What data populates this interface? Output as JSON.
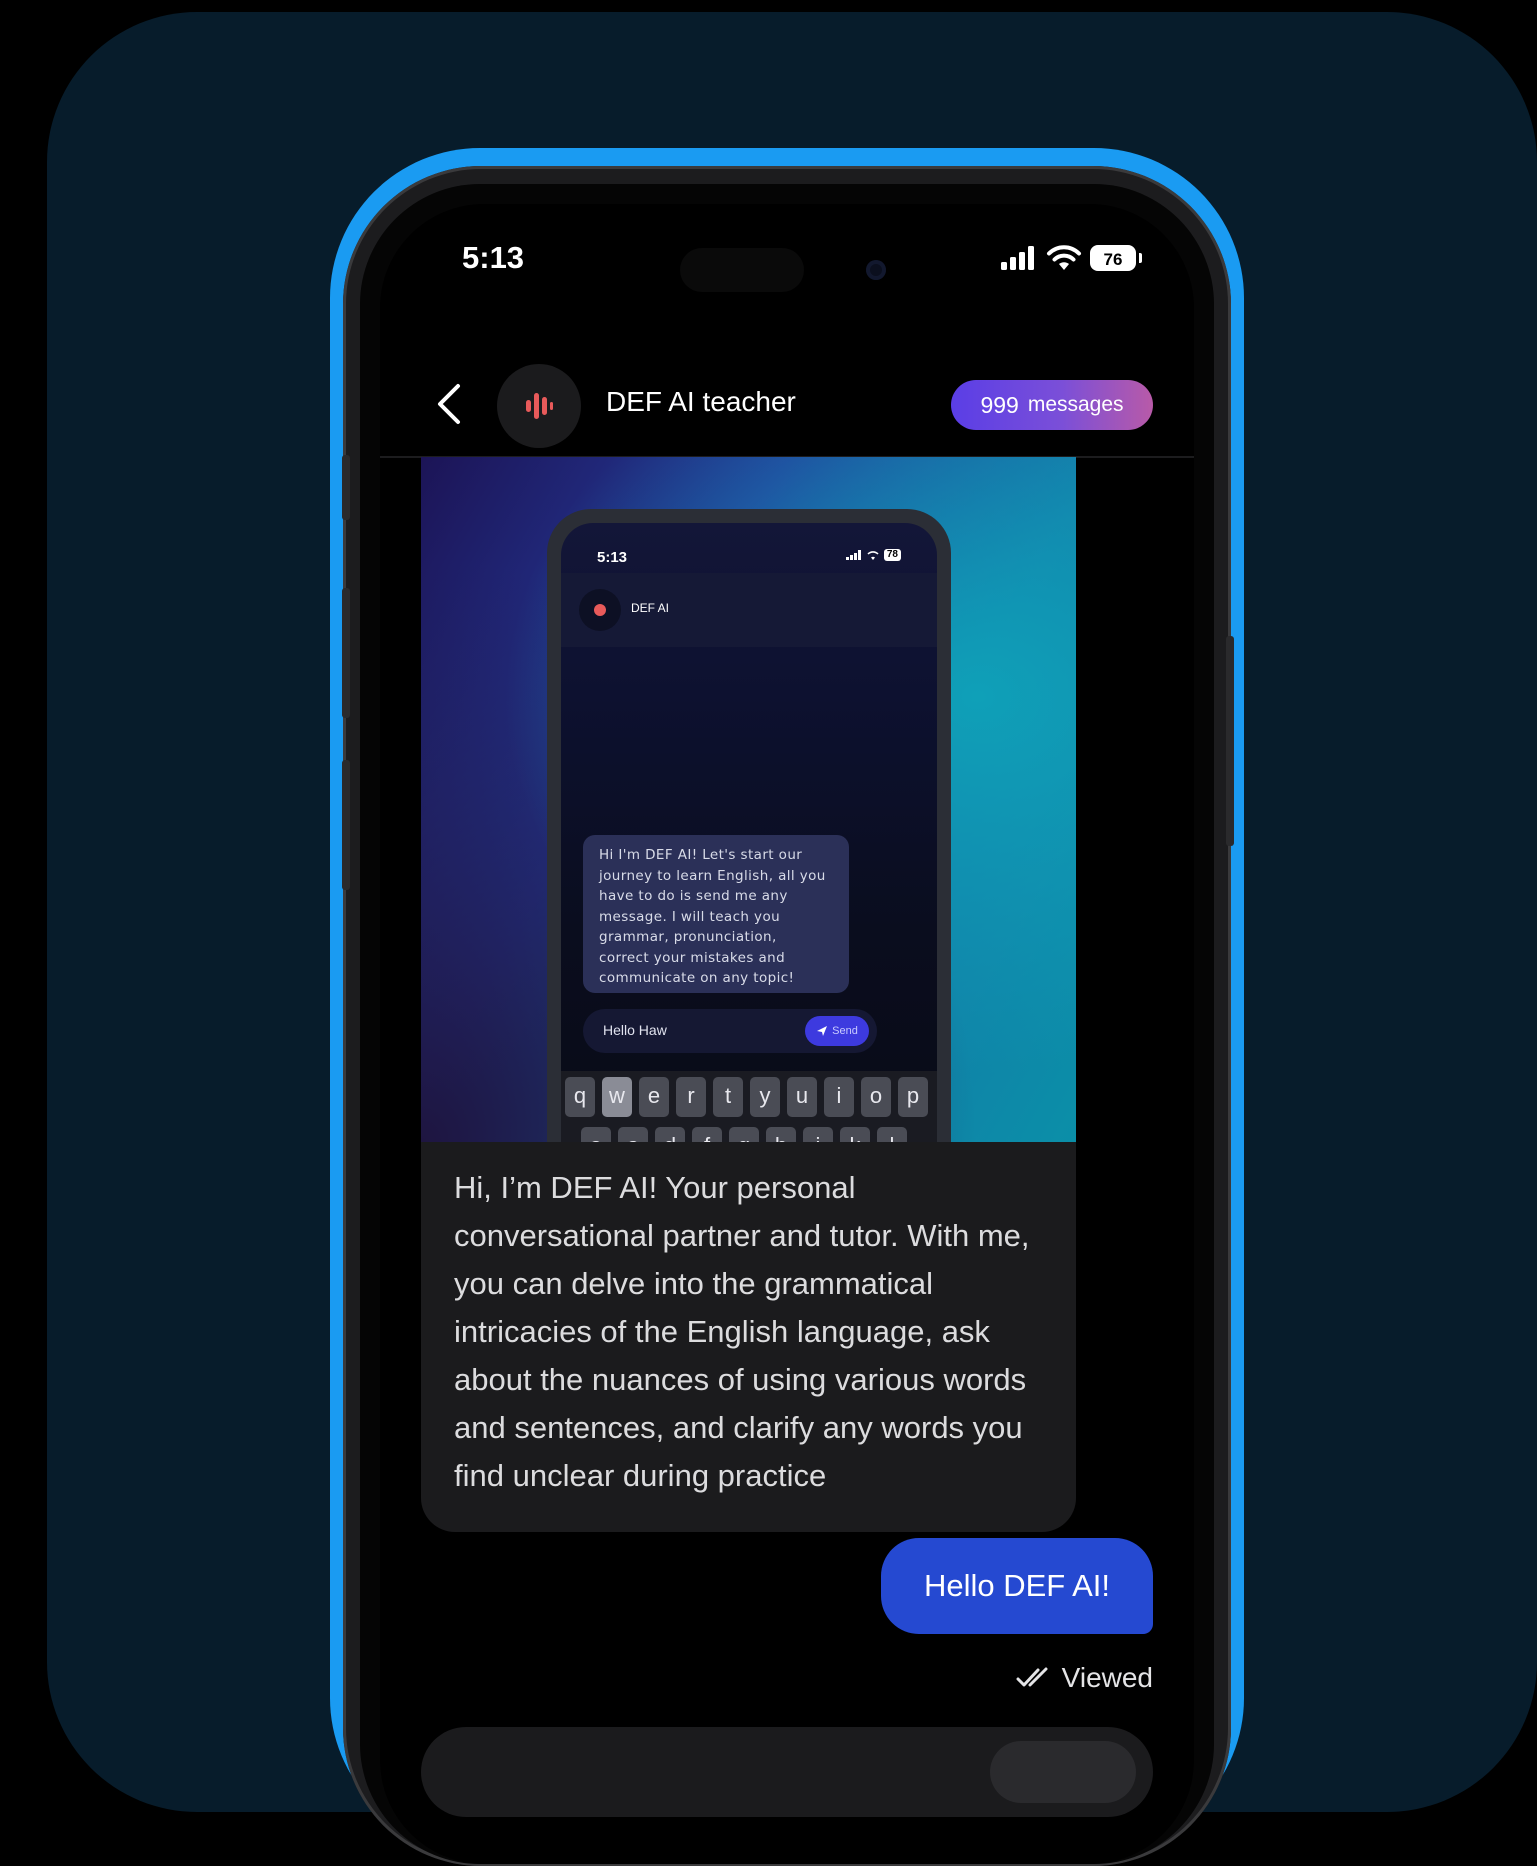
{
  "status_bar": {
    "time": "5:13",
    "battery": "76",
    "icons": [
      "cellular-signal-icon",
      "wifi-icon",
      "battery-icon"
    ]
  },
  "header": {
    "back_icon": "chevron-left-icon",
    "avatar_icon": "voice-wave-icon",
    "title": "DEF AI teacher",
    "message_count": "999",
    "message_label": "messages"
  },
  "preview_image": {
    "time": "5:13",
    "battery": "78",
    "title": "DEF AI",
    "bubble_lines": [
      "Hi I'm DEF AI! Let's start our",
      "journey to learn English, all you",
      "have to do is send me any",
      "message. I will teach you",
      "grammar, pronunciation,",
      "correct your mistakes and",
      "communicate on any topic!"
    ],
    "input_text": "Hello Haw",
    "send_label": "Send",
    "keys_row1": [
      "q",
      "w",
      "e",
      "r",
      "t",
      "y",
      "u",
      "i",
      "o",
      "p"
    ],
    "keys_row2": [
      "a",
      "s",
      "d",
      "f",
      "g",
      "h",
      "j",
      "k",
      "l"
    ]
  },
  "messages": {
    "ai_message": "Hi, I’m DEF AI! Your personal conversational partner and tutor. With me, you can delve into the grammatical intricacies of the English language, ask about the nuances of using various words and sentences, and clarify any words you find unclear during practice",
    "user_message": "Hello DEF AI!",
    "status": "Viewed"
  },
  "colors": {
    "background": "#071c2b",
    "phone_edge": "#1a9bf2",
    "accent_pill_start": "#5a3ee6",
    "accent_pill_end": "#b85aa8",
    "user_bubble": "#2549d1",
    "ai_bubble": "#1b1b1d",
    "recording_red": "#e85a5a"
  }
}
